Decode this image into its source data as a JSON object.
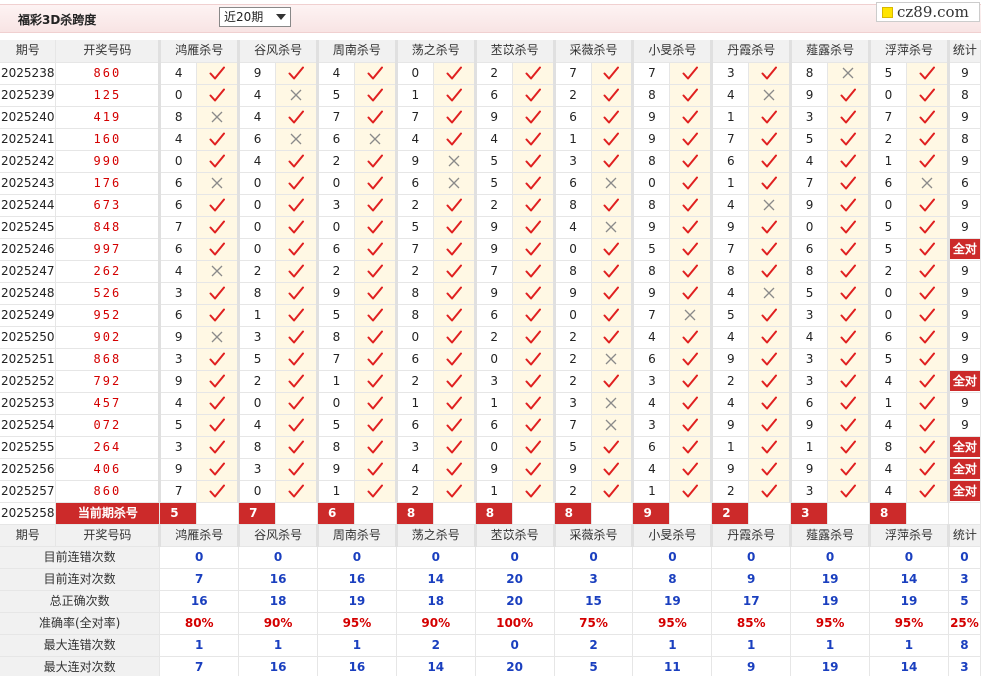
{
  "header": {
    "title": "福彩3D杀跨度",
    "period_select": "近20期",
    "site_logo": "cz89.com"
  },
  "columns": {
    "period": "期号",
    "code": "开奖号码",
    "experts": [
      "鸿雁杀号",
      "谷风杀号",
      "周南杀号",
      "荡之杀号",
      "苤苡杀号",
      "采薇杀号",
      "小旻杀号",
      "丹霞杀号",
      "薤露杀号",
      "浮萍杀号"
    ],
    "stat": "统计"
  },
  "legend": {
    "right_icon": "check-icon",
    "wrong_icon": "cross-icon",
    "all_right_label": "全对"
  },
  "colors": {
    "accent_red": "#cc2a2a",
    "check_red": "#e02020",
    "stat_blue": "#1a3fbf",
    "header_bg": "#f1f1f1",
    "mark_bg": "#fff8e4"
  },
  "rows": [
    {
      "period": "2025238",
      "code": "860",
      "picks": [
        4,
        9,
        4,
        0,
        2,
        7,
        7,
        3,
        8,
        5
      ],
      "ok": [
        1,
        1,
        1,
        1,
        1,
        1,
        1,
        1,
        0,
        1
      ],
      "stat": "9"
    },
    {
      "period": "2025239",
      "code": "125",
      "picks": [
        0,
        4,
        5,
        1,
        6,
        2,
        8,
        4,
        9,
        0
      ],
      "ok": [
        1,
        0,
        1,
        1,
        1,
        1,
        1,
        0,
        1,
        1
      ],
      "stat": "8"
    },
    {
      "period": "2025240",
      "code": "419",
      "picks": [
        8,
        4,
        7,
        7,
        9,
        6,
        9,
        1,
        3,
        7
      ],
      "ok": [
        0,
        1,
        1,
        1,
        1,
        1,
        1,
        1,
        1,
        1
      ],
      "stat": "9"
    },
    {
      "period": "2025241",
      "code": "160",
      "picks": [
        4,
        6,
        6,
        4,
        4,
        1,
        9,
        7,
        5,
        2
      ],
      "ok": [
        1,
        0,
        0,
        1,
        1,
        1,
        1,
        1,
        1,
        1
      ],
      "stat": "8"
    },
    {
      "period": "2025242",
      "code": "990",
      "picks": [
        0,
        4,
        2,
        9,
        5,
        3,
        8,
        6,
        4,
        1
      ],
      "ok": [
        1,
        1,
        1,
        0,
        1,
        1,
        1,
        1,
        1,
        1
      ],
      "stat": "9"
    },
    {
      "period": "2025243",
      "code": "176",
      "picks": [
        6,
        0,
        0,
        6,
        5,
        6,
        0,
        1,
        7,
        6
      ],
      "ok": [
        0,
        1,
        1,
        0,
        1,
        0,
        1,
        1,
        1,
        0
      ],
      "stat": "6"
    },
    {
      "period": "2025244",
      "code": "673",
      "picks": [
        6,
        0,
        3,
        2,
        2,
        8,
        8,
        4,
        9,
        0
      ],
      "ok": [
        1,
        1,
        1,
        1,
        1,
        1,
        1,
        0,
        1,
        1
      ],
      "stat": "9"
    },
    {
      "period": "2025245",
      "code": "848",
      "picks": [
        7,
        0,
        0,
        5,
        9,
        4,
        9,
        9,
        0,
        5
      ],
      "ok": [
        1,
        1,
        1,
        1,
        1,
        0,
        1,
        1,
        1,
        1
      ],
      "stat": "9"
    },
    {
      "period": "2025246",
      "code": "997",
      "picks": [
        6,
        0,
        6,
        7,
        9,
        0,
        5,
        7,
        6,
        5
      ],
      "ok": [
        1,
        1,
        1,
        1,
        1,
        1,
        1,
        1,
        1,
        1
      ],
      "stat": "全对"
    },
    {
      "period": "2025247",
      "code": "262",
      "picks": [
        4,
        2,
        2,
        2,
        7,
        8,
        8,
        8,
        8,
        2
      ],
      "ok": [
        0,
        1,
        1,
        1,
        1,
        1,
        1,
        1,
        1,
        1
      ],
      "stat": "9"
    },
    {
      "period": "2025248",
      "code": "526",
      "picks": [
        3,
        8,
        9,
        8,
        9,
        9,
        9,
        4,
        5,
        0
      ],
      "ok": [
        1,
        1,
        1,
        1,
        1,
        1,
        1,
        0,
        1,
        1
      ],
      "stat": "9"
    },
    {
      "period": "2025249",
      "code": "952",
      "picks": [
        6,
        1,
        5,
        8,
        6,
        0,
        7,
        5,
        3,
        0
      ],
      "ok": [
        1,
        1,
        1,
        1,
        1,
        1,
        0,
        1,
        1,
        1
      ],
      "stat": "9"
    },
    {
      "period": "2025250",
      "code": "902",
      "picks": [
        9,
        3,
        8,
        0,
        2,
        2,
        4,
        4,
        4,
        6
      ],
      "ok": [
        0,
        1,
        1,
        1,
        1,
        1,
        1,
        1,
        1,
        1
      ],
      "stat": "9"
    },
    {
      "period": "2025251",
      "code": "868",
      "picks": [
        3,
        5,
        7,
        6,
        0,
        2,
        6,
        9,
        3,
        5
      ],
      "ok": [
        1,
        1,
        1,
        1,
        1,
        0,
        1,
        1,
        1,
        1
      ],
      "stat": "9"
    },
    {
      "period": "2025252",
      "code": "792",
      "picks": [
        9,
        2,
        1,
        2,
        3,
        2,
        3,
        2,
        3,
        4
      ],
      "ok": [
        1,
        1,
        1,
        1,
        1,
        1,
        1,
        1,
        1,
        1
      ],
      "stat": "全对"
    },
    {
      "period": "2025253",
      "code": "457",
      "picks": [
        4,
        0,
        0,
        1,
        1,
        3,
        4,
        4,
        6,
        1
      ],
      "ok": [
        1,
        1,
        1,
        1,
        1,
        0,
        1,
        1,
        1,
        1
      ],
      "stat": "9"
    },
    {
      "period": "2025254",
      "code": "072",
      "picks": [
        5,
        4,
        5,
        6,
        6,
        7,
        3,
        9,
        9,
        4
      ],
      "ok": [
        1,
        1,
        1,
        1,
        1,
        0,
        1,
        1,
        1,
        1
      ],
      "stat": "9"
    },
    {
      "period": "2025255",
      "code": "264",
      "picks": [
        3,
        8,
        8,
        3,
        0,
        5,
        6,
        1,
        1,
        8
      ],
      "ok": [
        1,
        1,
        1,
        1,
        1,
        1,
        1,
        1,
        1,
        1
      ],
      "stat": "全对"
    },
    {
      "period": "2025256",
      "code": "406",
      "picks": [
        9,
        3,
        9,
        4,
        9,
        9,
        4,
        9,
        9,
        4
      ],
      "ok": [
        1,
        1,
        1,
        1,
        1,
        1,
        1,
        1,
        1,
        1
      ],
      "stat": "全对"
    },
    {
      "period": "2025257",
      "code": "860",
      "picks": [
        7,
        0,
        1,
        2,
        1,
        2,
        1,
        2,
        3,
        4
      ],
      "ok": [
        1,
        1,
        1,
        1,
        1,
        1,
        1,
        1,
        1,
        1
      ],
      "stat": "全对"
    }
  ],
  "current": {
    "period": "2025258",
    "label": "当前期杀号",
    "picks": [
      "5",
      "7",
      "6",
      "8",
      "8",
      "8",
      "9",
      "2",
      "3",
      "8"
    ]
  },
  "summary": {
    "rows": [
      {
        "label": "目前连错次数",
        "values": [
          "0",
          "0",
          "0",
          "0",
          "0",
          "0",
          "0",
          "0",
          "0",
          "0"
        ],
        "stat": "0"
      },
      {
        "label": "目前连对次数",
        "values": [
          "7",
          "16",
          "16",
          "14",
          "20",
          "3",
          "8",
          "9",
          "19",
          "14"
        ],
        "stat": "3"
      },
      {
        "label": "总正确次数",
        "values": [
          "16",
          "18",
          "19",
          "18",
          "20",
          "15",
          "19",
          "17",
          "19",
          "19"
        ],
        "stat": "5"
      },
      {
        "label": "准确率(全对率)",
        "values": [
          "80%",
          "90%",
          "95%",
          "90%",
          "100%",
          "75%",
          "95%",
          "85%",
          "95%",
          "95%"
        ],
        "stat": "25%"
      },
      {
        "label": "最大连错次数",
        "values": [
          "1",
          "1",
          "1",
          "2",
          "0",
          "2",
          "1",
          "1",
          "1",
          "1"
        ],
        "stat": "8"
      },
      {
        "label": "最大连对次数",
        "values": [
          "7",
          "16",
          "16",
          "14",
          "20",
          "5",
          "11",
          "9",
          "19",
          "14"
        ],
        "stat": "3"
      }
    ]
  }
}
